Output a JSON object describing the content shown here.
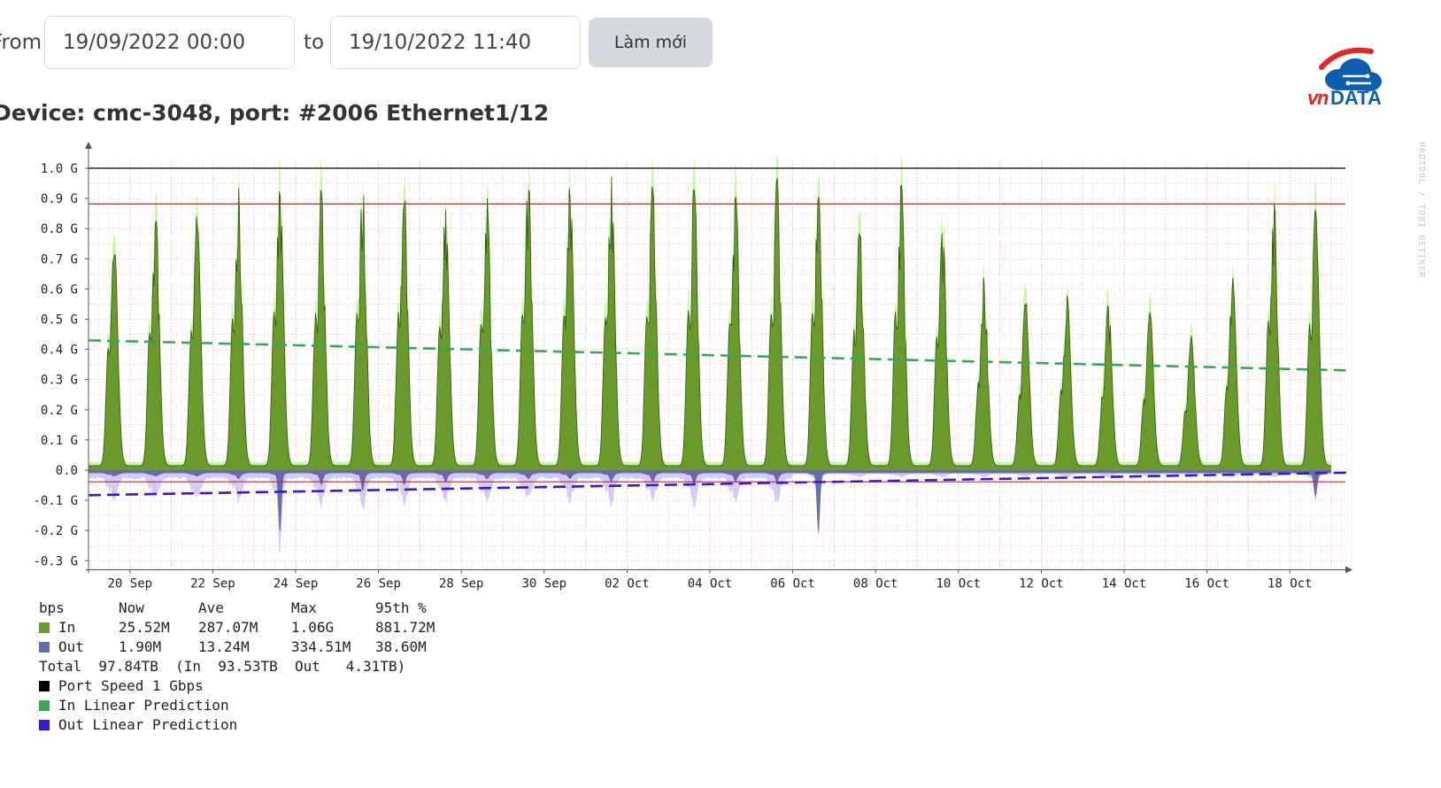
{
  "filters": {
    "from_label": "From",
    "from_value": "19/09/2022 00:00",
    "to_label": "to",
    "to_value": "19/10/2022 11:40",
    "refresh_label": "Làm mới"
  },
  "device_title": "Device: cmc-3048, port: #2006 Ethernet1/12",
  "logo": {
    "text_v": "v",
    "text_n": "n",
    "text_data": "DATA",
    "red": "#e52521",
    "blue": "#0c5fb0"
  },
  "watermark": "RRDTOOL / TOBI OETIKER",
  "colors": {
    "in_fill": "#6b9a2c",
    "in_max": "#c9f5a8",
    "out_fill": "#6a6aa8",
    "out_max": "#d0ccf3",
    "in_pred": "#35a85a",
    "out_pred": "#3a16d8",
    "speed": "#000000",
    "percentile": "#cc2020",
    "grid": "#f2b8b8"
  },
  "chart_data": {
    "type": "area",
    "ylabel": "",
    "ylim": [
      -0.33,
      1.0
    ],
    "y_ticks": [
      {
        "v": 1.0,
        "label": "1.0 G"
      },
      {
        "v": 0.9,
        "label": "0.9 G"
      },
      {
        "v": 0.8,
        "label": "0.8 G"
      },
      {
        "v": 0.7,
        "label": "0.7 G"
      },
      {
        "v": 0.6,
        "label": "0.6 G"
      },
      {
        "v": 0.5,
        "label": "0.5 G"
      },
      {
        "v": 0.4,
        "label": "0.4 G"
      },
      {
        "v": 0.3,
        "label": "0.3 G"
      },
      {
        "v": 0.2,
        "label": "0.2 G"
      },
      {
        "v": 0.1,
        "label": "0.1 G"
      },
      {
        "v": 0.0,
        "label": "0.0"
      },
      {
        "v": -0.1,
        "label": "-0.1 G"
      },
      {
        "v": -0.2,
        "label": "-0.2 G"
      },
      {
        "v": -0.3,
        "label": "-0.3 G"
      }
    ],
    "x_start": "2022-09-19",
    "x_end": "2022-10-19",
    "x_ticks": [
      {
        "date": "2022-09-20",
        "label": "20 Sep"
      },
      {
        "date": "2022-09-22",
        "label": "22 Sep"
      },
      {
        "date": "2022-09-24",
        "label": "24 Sep"
      },
      {
        "date": "2022-09-26",
        "label": "26 Sep"
      },
      {
        "date": "2022-09-28",
        "label": "28 Sep"
      },
      {
        "date": "2022-09-30",
        "label": "30 Sep"
      },
      {
        "date": "2022-10-02",
        "label": "02 Oct"
      },
      {
        "date": "2022-10-04",
        "label": "04 Oct"
      },
      {
        "date": "2022-10-06",
        "label": "06 Oct"
      },
      {
        "date": "2022-10-08",
        "label": "08 Oct"
      },
      {
        "date": "2022-10-10",
        "label": "10 Oct"
      },
      {
        "date": "2022-10-12",
        "label": "12 Oct"
      },
      {
        "date": "2022-10-14",
        "label": "14 Oct"
      },
      {
        "date": "2022-10-16",
        "label": "16 Oct"
      },
      {
        "date": "2022-10-18",
        "label": "18 Oct"
      }
    ],
    "daily_peaks": [
      {
        "date": "2022-09-19",
        "in": 0.77,
        "out": -0.02
      },
      {
        "date": "2022-09-20",
        "in": 0.88,
        "out": -0.02
      },
      {
        "date": "2022-09-21",
        "in": 0.87,
        "out": -0.02
      },
      {
        "date": "2022-09-22",
        "in": 0.94,
        "out": -0.03
      },
      {
        "date": "2022-09-23",
        "in": 0.98,
        "out": -0.21
      },
      {
        "date": "2022-09-24",
        "in": 0.95,
        "out": -0.05
      },
      {
        "date": "2022-09-25",
        "in": 0.97,
        "out": -0.07
      },
      {
        "date": "2022-09-26",
        "in": 0.94,
        "out": -0.05
      },
      {
        "date": "2022-09-27",
        "in": 0.89,
        "out": -0.04
      },
      {
        "date": "2022-09-28",
        "in": 0.93,
        "out": -0.03
      },
      {
        "date": "2022-09-29",
        "in": 0.98,
        "out": -0.03
      },
      {
        "date": "2022-09-30",
        "in": 0.98,
        "out": -0.03
      },
      {
        "date": "2022-10-01",
        "in": 0.98,
        "out": -0.04
      },
      {
        "date": "2022-10-02",
        "in": 0.98,
        "out": -0.04
      },
      {
        "date": "2022-10-03",
        "in": 0.97,
        "out": -0.05
      },
      {
        "date": "2022-10-04",
        "in": 0.94,
        "out": -0.04
      },
      {
        "date": "2022-10-05",
        "in": 0.98,
        "out": -0.04
      },
      {
        "date": "2022-10-06",
        "in": 0.97,
        "out": -0.21
      },
      {
        "date": "2022-10-07",
        "in": 0.84,
        "out": -0.01
      },
      {
        "date": "2022-10-08",
        "in": 0.96,
        "out": -0.01
      },
      {
        "date": "2022-10-09",
        "in": 0.82,
        "out": -0.01
      },
      {
        "date": "2022-10-10",
        "in": 0.65,
        "out": -0.01
      },
      {
        "date": "2022-10-11",
        "in": 0.58,
        "out": -0.01
      },
      {
        "date": "2022-10-12",
        "in": 0.61,
        "out": -0.01
      },
      {
        "date": "2022-10-13",
        "in": 0.57,
        "out": -0.01
      },
      {
        "date": "2022-10-14",
        "in": 0.54,
        "out": -0.01
      },
      {
        "date": "2022-10-15",
        "in": 0.45,
        "out": -0.01
      },
      {
        "date": "2022-10-16",
        "in": 0.65,
        "out": -0.01
      },
      {
        "date": "2022-10-17",
        "in": 0.9,
        "out": -0.01
      },
      {
        "date": "2022-10-18",
        "in": 0.9,
        "out": -0.09
      },
      {
        "date": "2022-10-19",
        "in": 0.8,
        "out": -0.01
      }
    ],
    "reference_lines": [
      {
        "name": "Port Speed 1 Gbps",
        "value": 1.0
      },
      {
        "value": 0.8817
      },
      {
        "value": -0.0386
      }
    ],
    "in_prediction": [
      [
        0.0,
        0.43
      ],
      [
        30.5,
        0.33
      ]
    ],
    "out_prediction": [
      [
        0.0,
        -0.083
      ],
      [
        30.5,
        -0.008
      ]
    ],
    "legend": {
      "header": [
        "bps",
        "Now",
        "Ave",
        "Max",
        "95th %"
      ],
      "rows": [
        {
          "name": "In",
          "now": "25.52M",
          "ave": "287.07M",
          "max": "1.06G",
          "p95": "881.72M"
        },
        {
          "name": "Out",
          "now": "1.90M",
          "ave": "13.24M",
          "max": "334.51M",
          "p95": "38.60M"
        }
      ],
      "total_text": "Total  97.84TB  (In  93.53TB  Out   4.31TB)",
      "port_speed": "Port Speed 1 Gbps",
      "in_pred": "In Linear Prediction",
      "out_pred": "Out Linear Prediction"
    }
  }
}
